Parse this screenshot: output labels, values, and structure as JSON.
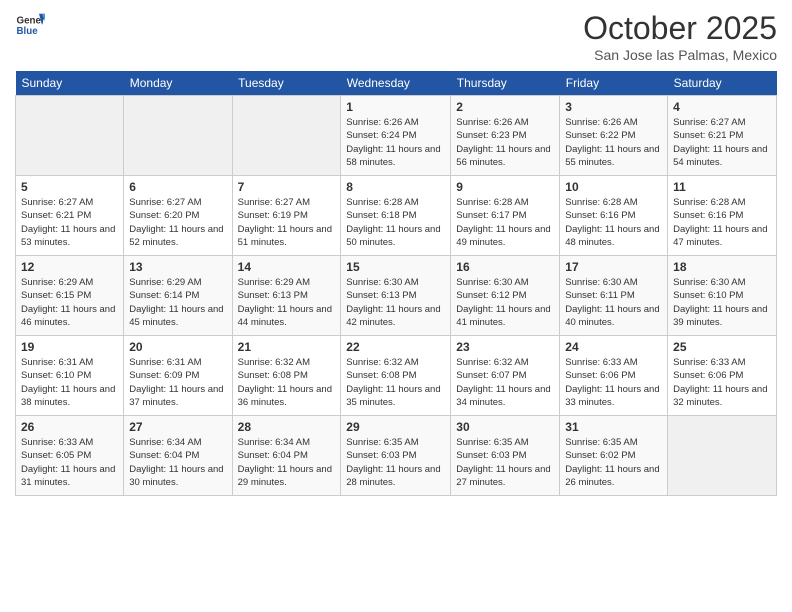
{
  "logo": {
    "general": "General",
    "blue": "Blue"
  },
  "header": {
    "month": "October 2025",
    "location": "San Jose las Palmas, Mexico"
  },
  "weekdays": [
    "Sunday",
    "Monday",
    "Tuesday",
    "Wednesday",
    "Thursday",
    "Friday",
    "Saturday"
  ],
  "weeks": [
    [
      {
        "day": "",
        "info": ""
      },
      {
        "day": "",
        "info": ""
      },
      {
        "day": "",
        "info": ""
      },
      {
        "day": "1",
        "info": "Sunrise: 6:26 AM\nSunset: 6:24 PM\nDaylight: 11 hours and 58 minutes."
      },
      {
        "day": "2",
        "info": "Sunrise: 6:26 AM\nSunset: 6:23 PM\nDaylight: 11 hours and 56 minutes."
      },
      {
        "day": "3",
        "info": "Sunrise: 6:26 AM\nSunset: 6:22 PM\nDaylight: 11 hours and 55 minutes."
      },
      {
        "day": "4",
        "info": "Sunrise: 6:27 AM\nSunset: 6:21 PM\nDaylight: 11 hours and 54 minutes."
      }
    ],
    [
      {
        "day": "5",
        "info": "Sunrise: 6:27 AM\nSunset: 6:21 PM\nDaylight: 11 hours and 53 minutes."
      },
      {
        "day": "6",
        "info": "Sunrise: 6:27 AM\nSunset: 6:20 PM\nDaylight: 11 hours and 52 minutes."
      },
      {
        "day": "7",
        "info": "Sunrise: 6:27 AM\nSunset: 6:19 PM\nDaylight: 11 hours and 51 minutes."
      },
      {
        "day": "8",
        "info": "Sunrise: 6:28 AM\nSunset: 6:18 PM\nDaylight: 11 hours and 50 minutes."
      },
      {
        "day": "9",
        "info": "Sunrise: 6:28 AM\nSunset: 6:17 PM\nDaylight: 11 hours and 49 minutes."
      },
      {
        "day": "10",
        "info": "Sunrise: 6:28 AM\nSunset: 6:16 PM\nDaylight: 11 hours and 48 minutes."
      },
      {
        "day": "11",
        "info": "Sunrise: 6:28 AM\nSunset: 6:16 PM\nDaylight: 11 hours and 47 minutes."
      }
    ],
    [
      {
        "day": "12",
        "info": "Sunrise: 6:29 AM\nSunset: 6:15 PM\nDaylight: 11 hours and 46 minutes."
      },
      {
        "day": "13",
        "info": "Sunrise: 6:29 AM\nSunset: 6:14 PM\nDaylight: 11 hours and 45 minutes."
      },
      {
        "day": "14",
        "info": "Sunrise: 6:29 AM\nSunset: 6:13 PM\nDaylight: 11 hours and 44 minutes."
      },
      {
        "day": "15",
        "info": "Sunrise: 6:30 AM\nSunset: 6:13 PM\nDaylight: 11 hours and 42 minutes."
      },
      {
        "day": "16",
        "info": "Sunrise: 6:30 AM\nSunset: 6:12 PM\nDaylight: 11 hours and 41 minutes."
      },
      {
        "day": "17",
        "info": "Sunrise: 6:30 AM\nSunset: 6:11 PM\nDaylight: 11 hours and 40 minutes."
      },
      {
        "day": "18",
        "info": "Sunrise: 6:30 AM\nSunset: 6:10 PM\nDaylight: 11 hours and 39 minutes."
      }
    ],
    [
      {
        "day": "19",
        "info": "Sunrise: 6:31 AM\nSunset: 6:10 PM\nDaylight: 11 hours and 38 minutes."
      },
      {
        "day": "20",
        "info": "Sunrise: 6:31 AM\nSunset: 6:09 PM\nDaylight: 11 hours and 37 minutes."
      },
      {
        "day": "21",
        "info": "Sunrise: 6:32 AM\nSunset: 6:08 PM\nDaylight: 11 hours and 36 minutes."
      },
      {
        "day": "22",
        "info": "Sunrise: 6:32 AM\nSunset: 6:08 PM\nDaylight: 11 hours and 35 minutes."
      },
      {
        "day": "23",
        "info": "Sunrise: 6:32 AM\nSunset: 6:07 PM\nDaylight: 11 hours and 34 minutes."
      },
      {
        "day": "24",
        "info": "Sunrise: 6:33 AM\nSunset: 6:06 PM\nDaylight: 11 hours and 33 minutes."
      },
      {
        "day": "25",
        "info": "Sunrise: 6:33 AM\nSunset: 6:06 PM\nDaylight: 11 hours and 32 minutes."
      }
    ],
    [
      {
        "day": "26",
        "info": "Sunrise: 6:33 AM\nSunset: 6:05 PM\nDaylight: 11 hours and 31 minutes."
      },
      {
        "day": "27",
        "info": "Sunrise: 6:34 AM\nSunset: 6:04 PM\nDaylight: 11 hours and 30 minutes."
      },
      {
        "day": "28",
        "info": "Sunrise: 6:34 AM\nSunset: 6:04 PM\nDaylight: 11 hours and 29 minutes."
      },
      {
        "day": "29",
        "info": "Sunrise: 6:35 AM\nSunset: 6:03 PM\nDaylight: 11 hours and 28 minutes."
      },
      {
        "day": "30",
        "info": "Sunrise: 6:35 AM\nSunset: 6:03 PM\nDaylight: 11 hours and 27 minutes."
      },
      {
        "day": "31",
        "info": "Sunrise: 6:35 AM\nSunset: 6:02 PM\nDaylight: 11 hours and 26 minutes."
      },
      {
        "day": "",
        "info": ""
      }
    ]
  ]
}
